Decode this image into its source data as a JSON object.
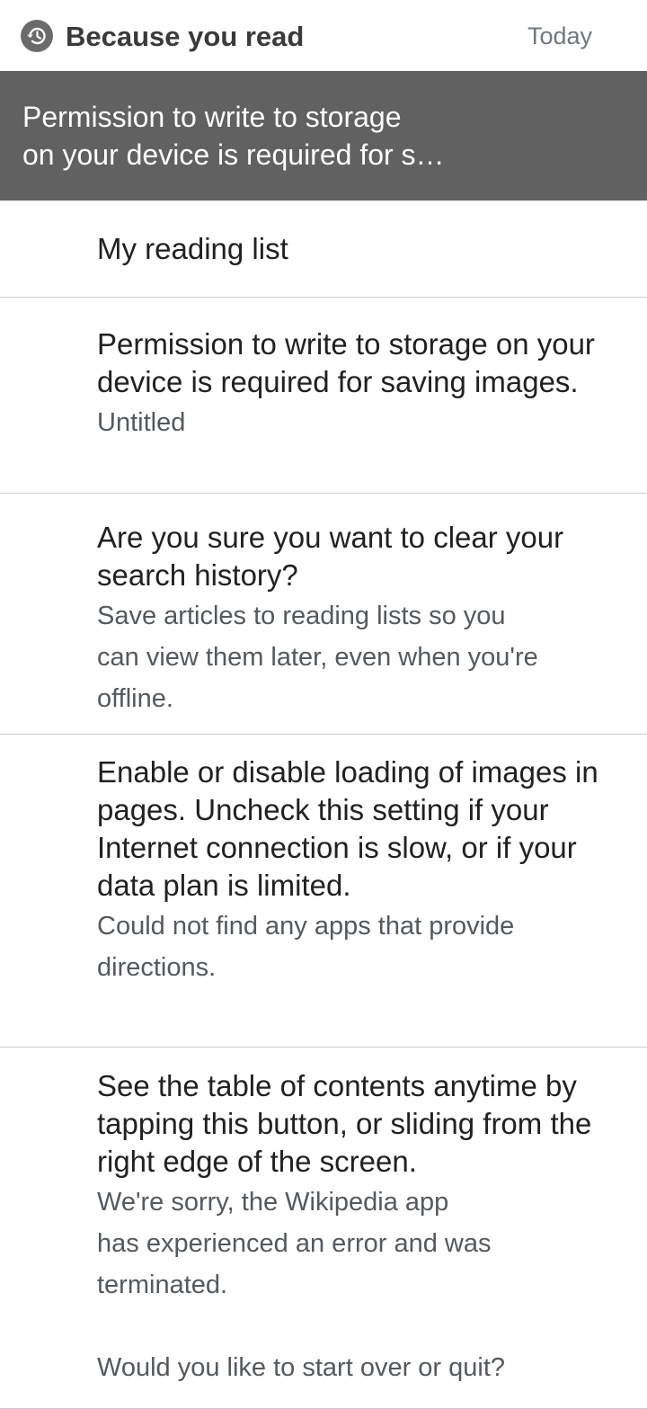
{
  "header": {
    "icon": "history-icon",
    "title": "Because you read",
    "date": "Today"
  },
  "banner": {
    "line1": "Permission to write to storage",
    "line2": "on your device is required for s…"
  },
  "items": [
    {
      "title": "My reading list",
      "subtitle_lines": []
    },
    {
      "title": "Permission to write to storage on your device is required for saving images.",
      "subtitle_lines": [
        "Untitled"
      ]
    },
    {
      "title": "Are you sure you want to clear your search history?",
      "subtitle_lines": [
        "Save articles to reading lists so you",
        "can view them later, even when you're",
        "offline."
      ]
    },
    {
      "title": "Enable or disable loading of images in pages. Uncheck this setting if your Internet connection is slow, or if your data plan is limited.",
      "subtitle_lines": [
        "Could not find any apps that provide",
        "directions."
      ]
    },
    {
      "title": "See the table of contents anytime by tapping this button, or sliding from the right edge of the screen.",
      "subtitle_lines": [
        "We're sorry, the Wikipedia app",
        "has experienced an error and was",
        "terminated.",
        "",
        "Would you like to start over or quit?"
      ]
    }
  ]
}
